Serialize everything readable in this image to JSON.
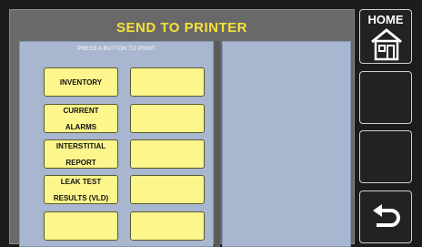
{
  "title": "SEND TO PRINTER",
  "instruction": "PRESS A BUTTON TO PRINT",
  "buttons": [
    {
      "label1": "INVENTORY",
      "label2": ""
    },
    {
      "label1": "",
      "label2": ""
    },
    {
      "label1": "CURRENT",
      "label2": "ALARMS"
    },
    {
      "label1": "",
      "label2": ""
    },
    {
      "label1": "INTERSTITIAL",
      "label2": "REPORT"
    },
    {
      "label1": "",
      "label2": ""
    },
    {
      "label1": "LEAK TEST",
      "label2": "RESULTS (VLD)"
    },
    {
      "label1": "",
      "label2": ""
    },
    {
      "label1": "",
      "label2": ""
    },
    {
      "label1": "",
      "label2": ""
    }
  ],
  "sidebar": {
    "home_label": "HOME",
    "home_icon": "home-icon",
    "back_icon": "back-arrow-icon"
  },
  "colors": {
    "title": "#f5e23a",
    "button": "#fdf68c",
    "panel": "#a9b6d0"
  }
}
